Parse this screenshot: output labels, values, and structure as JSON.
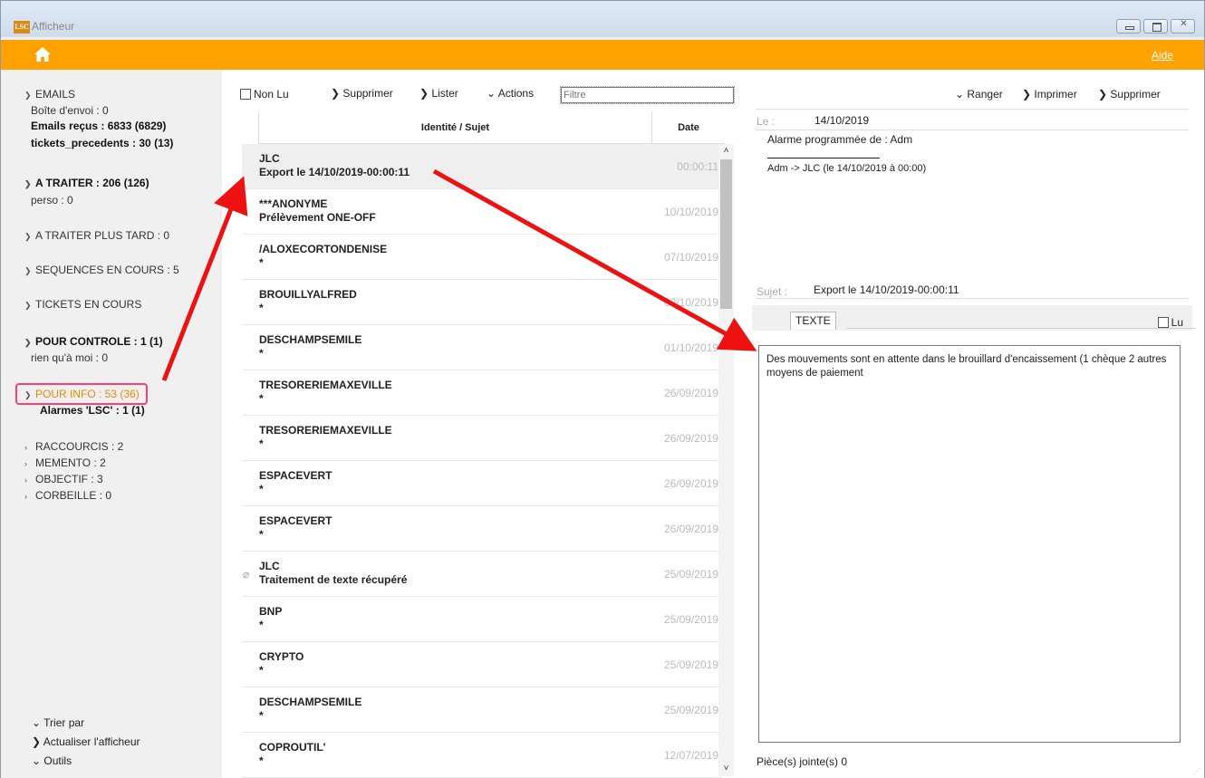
{
  "window": {
    "title": "Afficheur",
    "logo_text": "LSC"
  },
  "header": {
    "aide_label": "Aide",
    "bar_color": "#ffa200"
  },
  "sidebar": {
    "emails": "EMAILS",
    "boite_envoi": "Boîte d'envoi : 0",
    "emails_recus": "Emails reçus : 6833 (6829)",
    "tickets_precedents": "tickets_precedents : 30 (13)",
    "a_traiter": "A TRAITER : 206 (126)",
    "perso": "perso : 0",
    "a_traiter_plus_tard": "A TRAITER PLUS TARD : 0",
    "sequences": "SEQUENCES EN COURS : 5",
    "tickets_en_cours": "TICKETS EN COURS",
    "pour_controle": "POUR CONTROLE : 1 (1)",
    "rien_qua_moi": "rien qu'à moi : 0",
    "pour_info": "POUR INFO : 53 (36)",
    "alarmes": "Alarmes 'LSC' : 1 (1)",
    "raccourcis": "RACCOURCIS : 2",
    "memento": "MEMENTO : 2",
    "objectif": "OBJECTIF : 3",
    "corbeille": "CORBEILLE : 0",
    "trier_par": "Trier par",
    "actualiser": "Actualiser l'afficheur",
    "outils": "Outils",
    "highlight_color": "#ff3d78"
  },
  "list": {
    "non_lu": "Non Lu",
    "supprimer": "Supprimer",
    "lister": "Lister",
    "actions": "Actions",
    "filtre_placeholder": "Filtre",
    "col_identite": "Identité / Sujet",
    "col_date": "Date",
    "rows": [
      {
        "ident": "JLC",
        "subject": "Export le 14/10/2019-00:00:11",
        "date": "00:00:11",
        "selected": true,
        "attachment": false
      },
      {
        "ident": "***ANONYME",
        "subject": "Prélèvement ONE-OFF",
        "date": "10/10/2019",
        "selected": false,
        "attachment": false
      },
      {
        "ident": "/ALOXECORTONDENISE",
        "subject": "*",
        "date": "07/10/2019",
        "selected": false,
        "attachment": false
      },
      {
        "ident": "BROUILLYALFRED",
        "subject": "*",
        "date": "02/10/2019",
        "selected": false,
        "attachment": false
      },
      {
        "ident": "DESCHAMPSEMILE",
        "subject": "*",
        "date": "01/10/2019",
        "selected": false,
        "attachment": false
      },
      {
        "ident": "TRESORERIEMAXEVILLE",
        "subject": "*",
        "date": "26/09/2019",
        "selected": false,
        "attachment": false
      },
      {
        "ident": "TRESORERIEMAXEVILLE",
        "subject": "*",
        "date": "26/09/2019",
        "selected": false,
        "attachment": false
      },
      {
        "ident": "ESPACEVERT",
        "subject": "*",
        "date": "26/09/2019",
        "selected": false,
        "attachment": false
      },
      {
        "ident": "ESPACEVERT",
        "subject": "*",
        "date": "26/09/2019",
        "selected": false,
        "attachment": false
      },
      {
        "ident": "JLC",
        "subject": "Traitement de texte récupéré",
        "date": "25/09/2019",
        "selected": false,
        "attachment": true
      },
      {
        "ident": "BNP",
        "subject": "*",
        "date": "25/09/2019",
        "selected": false,
        "attachment": false
      },
      {
        "ident": "CRYPTO",
        "subject": "*",
        "date": "25/09/2019",
        "selected": false,
        "attachment": false
      },
      {
        "ident": "DESCHAMPSEMILE",
        "subject": "*",
        "date": "25/09/2019",
        "selected": false,
        "attachment": false
      },
      {
        "ident": "COPROUTIL'",
        "subject": "*",
        "date": "12/07/2019",
        "selected": false,
        "attachment": false
      }
    ]
  },
  "detail": {
    "ranger": "Ranger",
    "imprimer": "Imprimer",
    "supprimer": "Supprimer",
    "le_label": "Le :",
    "le_value": "14/10/2019",
    "alarm_text": "Alarme programmée de : Adm",
    "adm_line": "Adm -> JLC (le 14/10/2019 à 00:00)",
    "sujet_label": "Sujet :",
    "sujet_value": "Export le 14/10/2019-00:00:11",
    "tab_texte": "TEXTE",
    "lu_label": "Lu",
    "body_text": "Des mouvements sont en attente dans le brouillard d'encaissement (1 chèque 2 autres moyens de paiement",
    "pieces_jointes": "Pièce(s) jointe(s)  0"
  },
  "annotation_color": "#ee1111"
}
